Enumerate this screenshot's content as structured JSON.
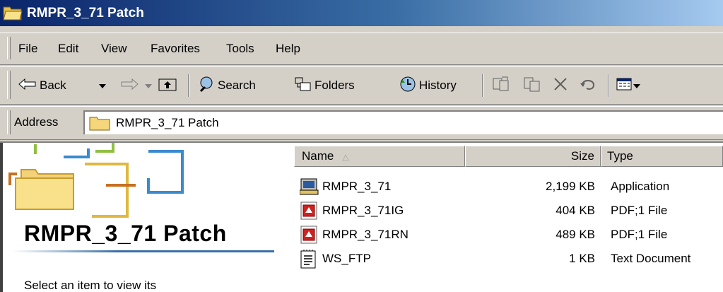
{
  "window": {
    "title": "RMPR_3_71 Patch"
  },
  "menu": {
    "items": [
      "File",
      "Edit",
      "View",
      "Favorites",
      "Tools",
      "Help"
    ]
  },
  "toolbar": {
    "back": "Back",
    "search": "Search",
    "folders": "Folders",
    "history": "History"
  },
  "address": {
    "label": "Address",
    "value": "RMPR_3_71 Patch"
  },
  "left_pane": {
    "title": "RMPR_3_71 Patch",
    "description": "Select an item to view its"
  },
  "columns": {
    "name": "Name",
    "size": "Size",
    "type": "Type"
  },
  "files": [
    {
      "name": "RMPR_3_71",
      "size": "2,199 KB",
      "type": "Application",
      "icon": "application-icon"
    },
    {
      "name": "RMPR_3_71IG",
      "size": "404 KB",
      "type": "PDF;1 File",
      "icon": "pdf-file-icon"
    },
    {
      "name": "RMPR_3_71RN",
      "size": "489 KB",
      "type": "PDF;1 File",
      "icon": "pdf-file-icon"
    },
    {
      "name": "WS_FTP",
      "size": "1 KB",
      "type": "Text Document",
      "icon": "text-document-icon"
    }
  ],
  "colors": {
    "title_gradient_start": "#0a246a",
    "title_gradient_end": "#a6caf0",
    "face": "#d4d0c8",
    "folder": "#f5d67a"
  }
}
